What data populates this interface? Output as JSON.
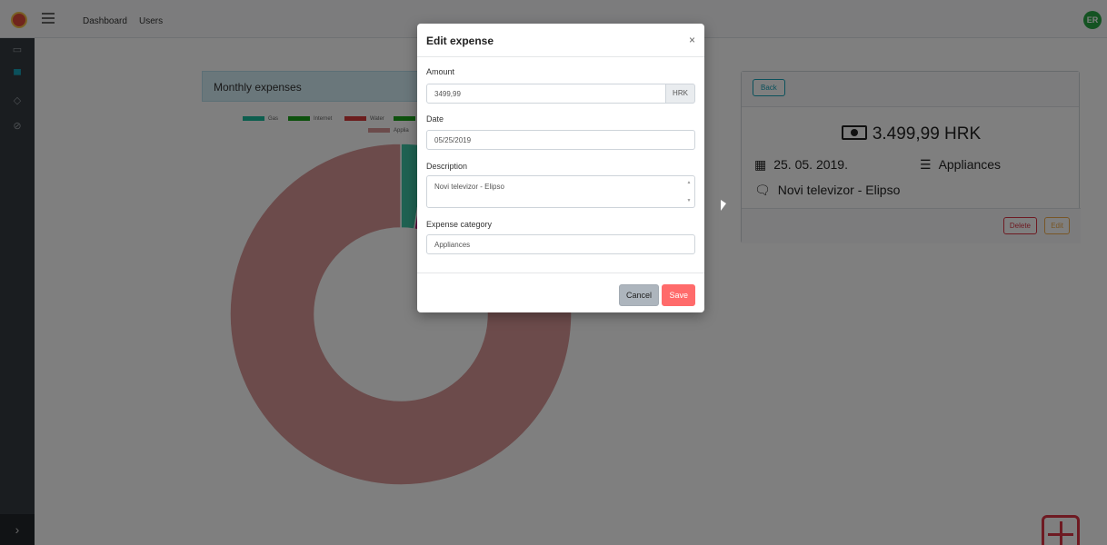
{
  "header": {
    "nav": [
      "Dashboard",
      "Users"
    ],
    "avatar_initials": "ER"
  },
  "sidebar": {
    "icons": [
      "money-icon",
      "cart-icon",
      "drop-icon",
      "ban-icon"
    ],
    "collapse_icon": "chevron-right-icon"
  },
  "chart_card": {
    "title": "Monthly expenses"
  },
  "chart_data": {
    "type": "pie",
    "title": "",
    "categories": [
      "Gas",
      "Internet",
      "Water",
      "",
      "Appliances"
    ],
    "colors": [
      "#1abc9c",
      "#1aa31a",
      "#d63a3a",
      "#1aa31a",
      "#d89696",
      "#bf1a82"
    ],
    "visible_legend": [
      "Gas",
      "Internet",
      "Water",
      "Applia"
    ],
    "slices": [
      {
        "label": "Gas",
        "value": 2.5,
        "color": "#3fc4a5"
      },
      {
        "label": "",
        "value": 17.0,
        "color": "#bf1a82"
      },
      {
        "label": "Appliances",
        "value": 80.5,
        "color": "#d89696"
      }
    ]
  },
  "detail_card": {
    "back_label": "Back",
    "amount": "3.499,99 HRK",
    "date": "25. 05. 2019.",
    "category": "Appliances",
    "description": "Novi televizor - Elipso",
    "delete_label": "Delete",
    "edit_label": "Edit"
  },
  "modal": {
    "title": "Edit expense",
    "close": "×",
    "amount_label": "Amount",
    "amount_value": "3499,99",
    "currency": "HRK",
    "date_label": "Date",
    "date_value": "05/25/2019",
    "description_label": "Description",
    "description_value": "Novi televizor - Elipso",
    "category_label": "Expense category",
    "category_value": "Appliances",
    "cancel_label": "Cancel",
    "save_label": "Save"
  }
}
